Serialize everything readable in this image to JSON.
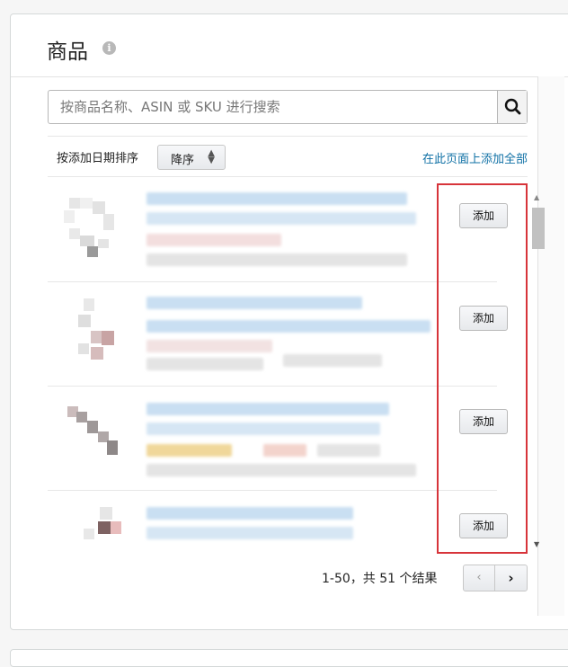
{
  "header": {
    "title": "商品",
    "info_icon_glyph": "i"
  },
  "search": {
    "placeholder": "按商品名称、ASIN 或 SKU 进行搜索",
    "icon": "search-icon"
  },
  "sort": {
    "label": "按添加日期排序",
    "selected": "降序"
  },
  "add_all_link": "在此页面上添加全部",
  "products": [
    {
      "add_label": "添加"
    },
    {
      "add_label": "添加"
    },
    {
      "add_label": "添加"
    },
    {
      "add_label": "添加"
    }
  ],
  "pagination": {
    "summary": "1-50，共 51 个结果",
    "prev": "‹",
    "next": "›"
  },
  "colors": {
    "highlight_border": "#d7343a",
    "link": "#0f70a5"
  }
}
